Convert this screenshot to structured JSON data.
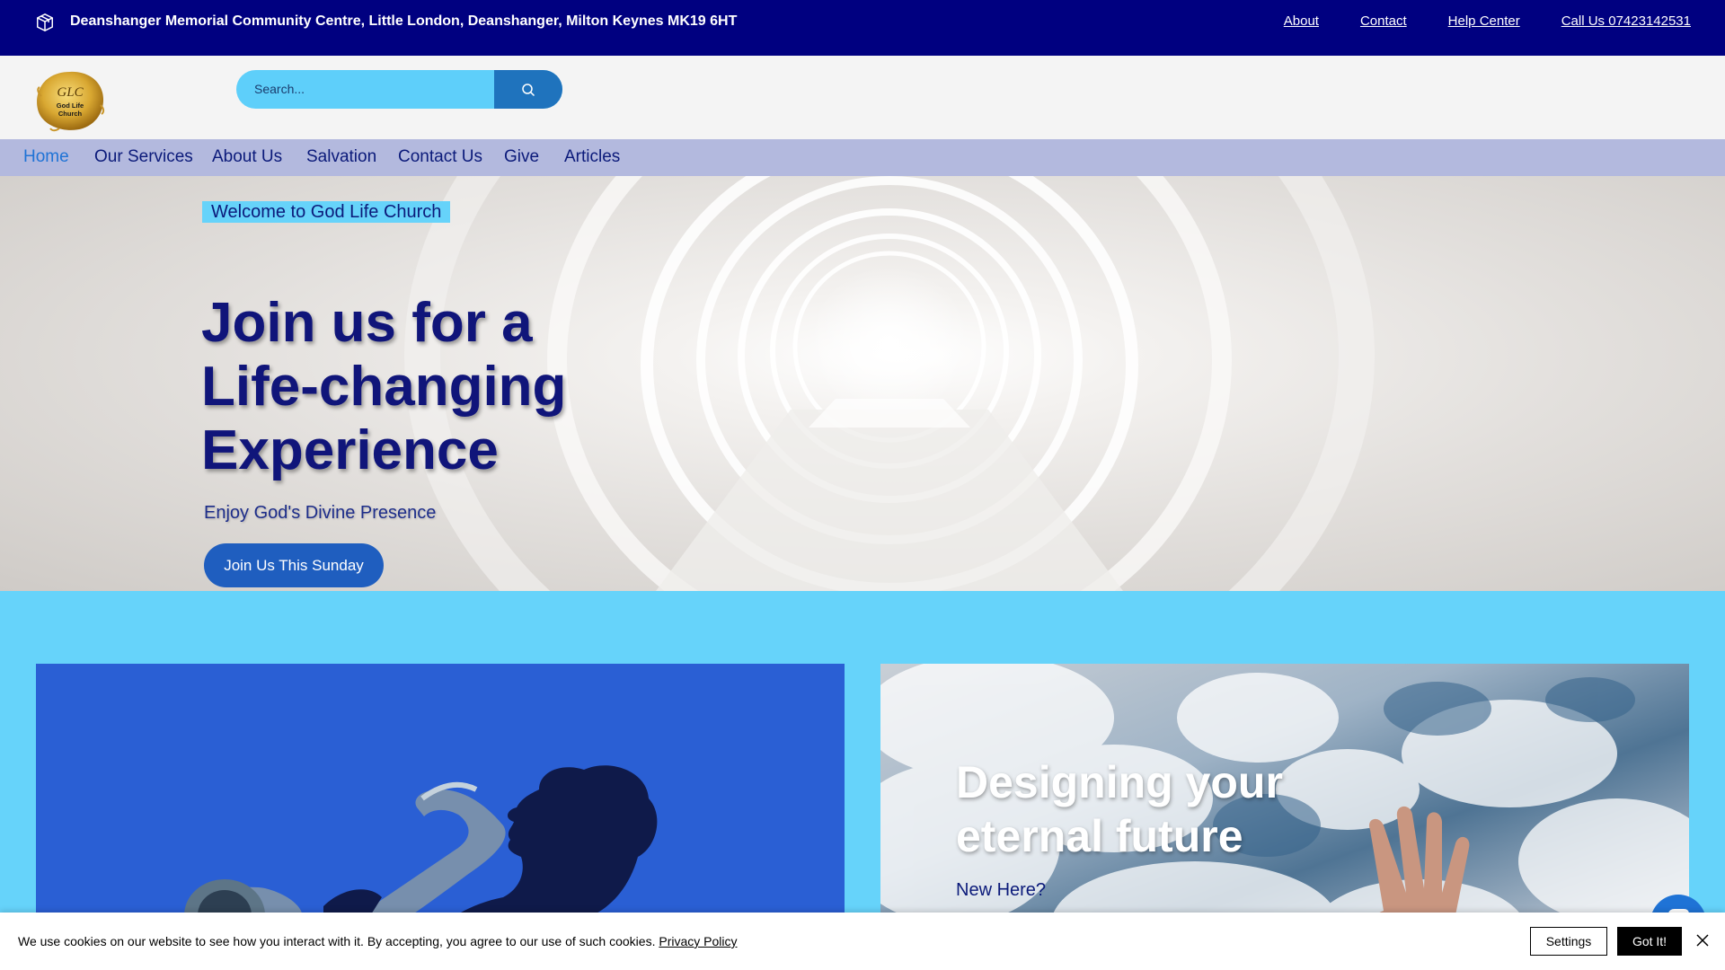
{
  "topbar": {
    "address": "Deanshanger Memorial Community Centre, Little London, Deanshanger, Milton Keynes MK19 6HT",
    "links": [
      {
        "label": "About"
      },
      {
        "label": "Contact"
      },
      {
        "label": "Help Center"
      },
      {
        "label": "Call Us 07423142531"
      }
    ]
  },
  "header": {
    "logo_text": [
      "GLC",
      "God Life",
      "Church"
    ],
    "search": {
      "placeholder": "Search..."
    }
  },
  "nav": {
    "items": [
      {
        "label": "Home",
        "active": true
      },
      {
        "label": "Our Services"
      },
      {
        "label": "About Us"
      },
      {
        "label": "Salvation"
      },
      {
        "label": "Contact Us"
      },
      {
        "label": "Give"
      },
      {
        "label": "Articles"
      }
    ]
  },
  "hero": {
    "badge": "Welcome to God Life Church",
    "title_lines": [
      "Join us for a",
      "Life-changing",
      "Experience"
    ],
    "subtitle": "Enjoy God's Divine Presence",
    "button": "Join Us This Sunday"
  },
  "cards": {
    "right": {
      "title_lines": [
        "Designing your",
        "eternal future"
      ],
      "subtitle": "New Here?"
    }
  },
  "cookie": {
    "message": "We use cookies on our website to see how you interact with it. By accepting, you agree to our use of such cookies.",
    "policy_link": "Privacy Policy",
    "settings": "Settings",
    "accept": "Got It!"
  },
  "colors": {
    "topbar": "#000080",
    "accent": "#66d3fa",
    "nav_bg": "#b3b9de",
    "button": "#1f5ebf",
    "heading": "#10157a"
  },
  "icons": [
    "package-icon",
    "search-icon",
    "chat-icon",
    "close-icon"
  ]
}
